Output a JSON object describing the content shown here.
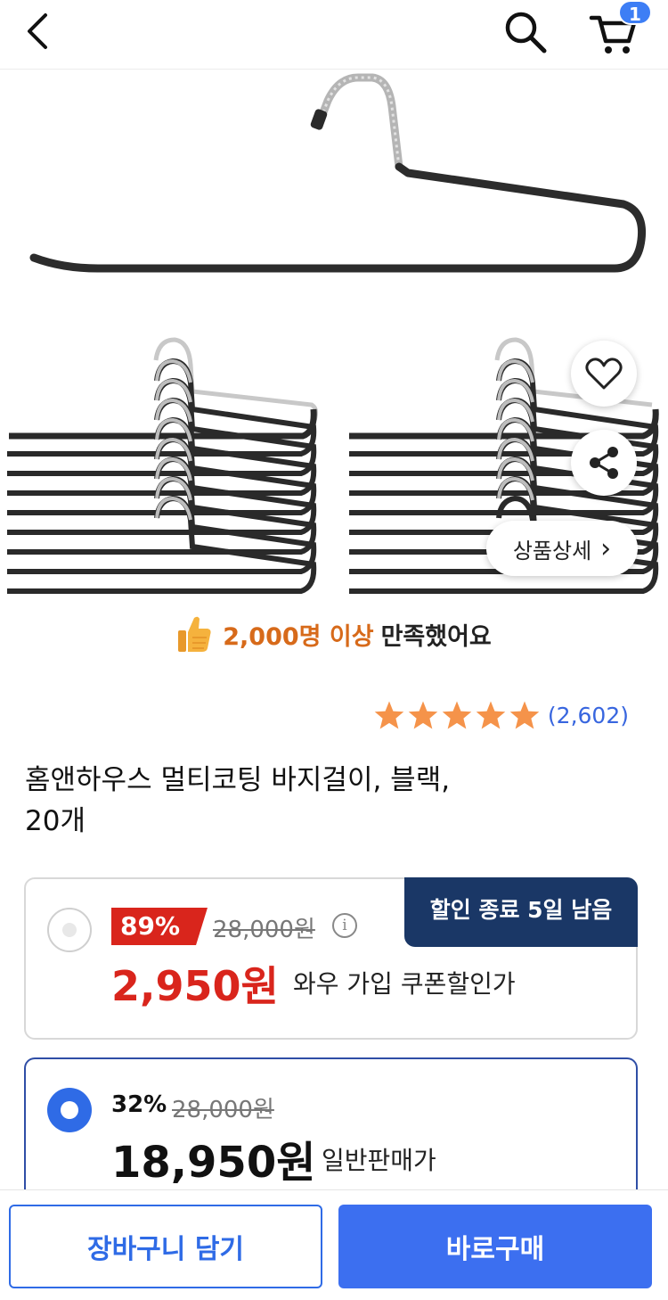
{
  "header": {
    "back_icon": "chevron-left-icon",
    "search_icon": "search-icon",
    "cart_icon": "cart-icon",
    "cart_badge": "1"
  },
  "product_image": {
    "subject": "trouser hangers",
    "heart_icon": "heart-icon",
    "share_icon": "share-icon",
    "detail_label": "상품상세",
    "detail_chevron": "›"
  },
  "satisfaction": {
    "icon": "thumbs-up-icon",
    "highlight": "2,000명 이상",
    "rest": "만족했어요"
  },
  "rating": {
    "stars": 5,
    "count": "(2,602)",
    "star_color": "#f5934a"
  },
  "product": {
    "title_line1": "홈앤하우스 멀티코팅 바지걸이, 블랙,",
    "title_line2": "20개"
  },
  "options": [
    {
      "selected": false,
      "discount": "89%",
      "original_price": "28,000원",
      "price": "2,950원",
      "price_label": "와우 가입 쿠폰할인가",
      "badge": "할인 종료 5일 남음",
      "info_icon": "info-icon"
    },
    {
      "selected": true,
      "discount": "32%",
      "original_price": "28,000원",
      "price": "18,950원",
      "price_label": "일반판매가"
    }
  ],
  "bottom_bar": {
    "add_to_cart": "장바구니 담기",
    "buy_now": "바로구매"
  },
  "colors": {
    "accent": "#3c6ff0",
    "sale_red": "#d9251c",
    "badge_navy": "#1a3766",
    "highlight_orange": "#d76a1a"
  }
}
